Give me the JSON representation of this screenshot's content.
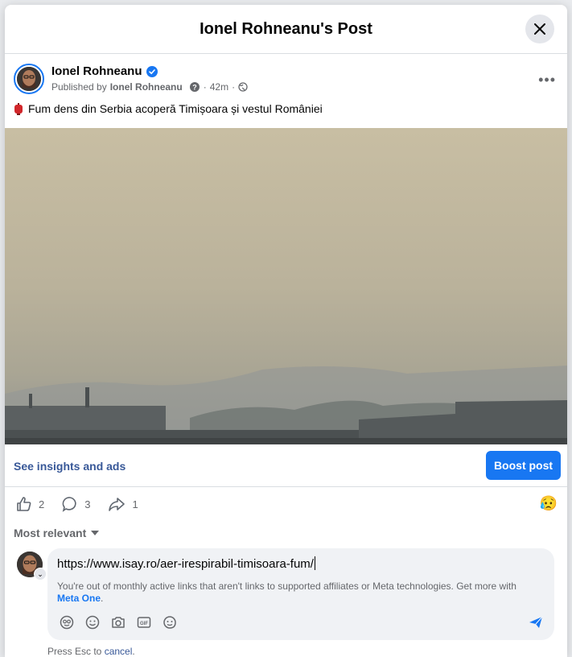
{
  "modal": {
    "title": "Ionel Rohneanu's Post"
  },
  "post": {
    "author": "Ionel Rohneanu",
    "published_prefix": "Published by",
    "published_by": "Ionel Rohneanu",
    "time": "42m",
    "text": "Fum dens din Serbia acoperă Timișoara și vestul României"
  },
  "insights": {
    "link": "See insights and ads",
    "boost": "Boost post"
  },
  "stats": {
    "likes": "2",
    "comments": "3",
    "shares": "1"
  },
  "sort": {
    "label": "Most relevant"
  },
  "composer": {
    "value": "https://www.isay.ro/aer-irespirabil-timisoara-fum/",
    "note": "You're out of monthly active links that aren't links to supported affiliates or Meta technologies. Get more with",
    "note_link": "Meta One",
    "esc_prefix": "Press Esc to",
    "esc_cancel": "cancel"
  },
  "colors": {
    "accent": "#1877f2",
    "link": "#385898",
    "muted": "#65676b"
  }
}
